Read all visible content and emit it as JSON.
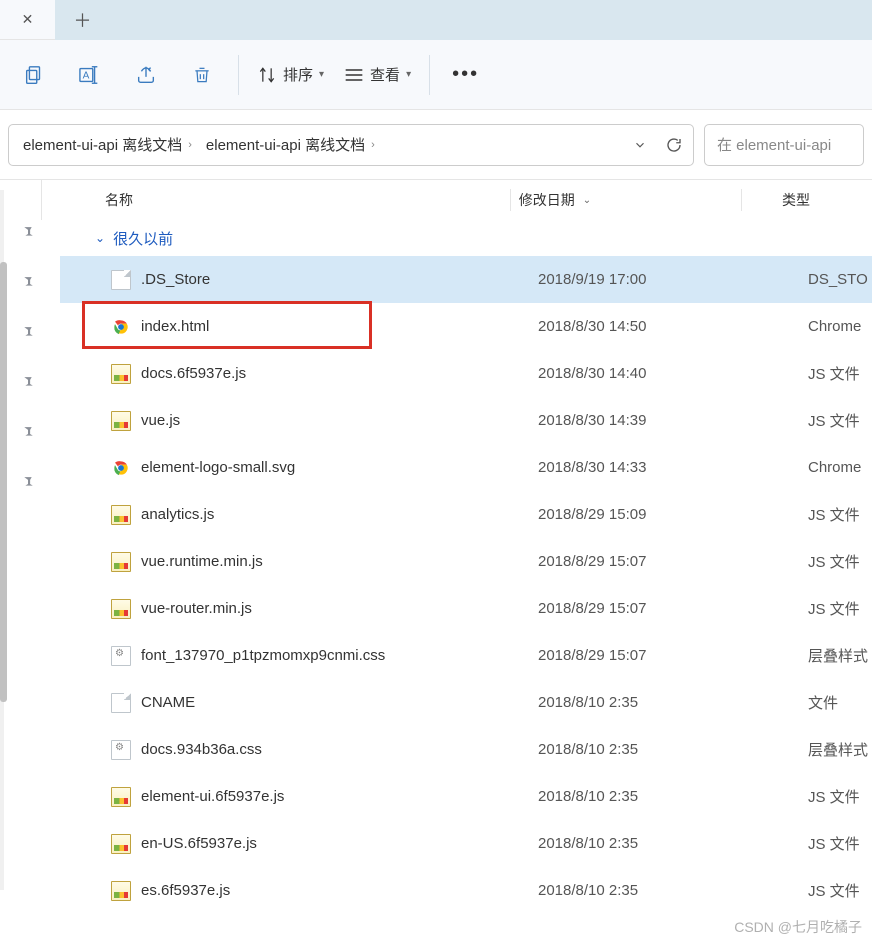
{
  "tabs": {
    "close_glyph": "✕",
    "new_glyph": "＋"
  },
  "toolbar": {
    "sort_label": "排序",
    "view_label": "查看"
  },
  "breadcrumb": {
    "items": [
      "element-ui-api 离线文档",
      "element-ui-api 离线文档"
    ],
    "sep": "›"
  },
  "search": {
    "placeholder": "在 element-ui-api"
  },
  "columns": {
    "name": "名称",
    "date": "修改日期",
    "type": "类型"
  },
  "group": {
    "label": "很久以前"
  },
  "files": [
    {
      "name": ".DS_Store",
      "date": "2018/9/19 17:00",
      "type": "DS_STO",
      "icon": "blank",
      "selected": true
    },
    {
      "name": "index.html",
      "date": "2018/8/30 14:50",
      "type": "Chrome",
      "icon": "chrome",
      "highlight": true
    },
    {
      "name": "docs.6f5937e.js",
      "date": "2018/8/30 14:40",
      "type": "JS 文件",
      "icon": "js"
    },
    {
      "name": "vue.js",
      "date": "2018/8/30 14:39",
      "type": "JS 文件",
      "icon": "js"
    },
    {
      "name": "element-logo-small.svg",
      "date": "2018/8/30 14:33",
      "type": "Chrome",
      "icon": "chrome"
    },
    {
      "name": "analytics.js",
      "date": "2018/8/29 15:09",
      "type": "JS 文件",
      "icon": "js"
    },
    {
      "name": "vue.runtime.min.js",
      "date": "2018/8/29 15:07",
      "type": "JS 文件",
      "icon": "js"
    },
    {
      "name": "vue-router.min.js",
      "date": "2018/8/29 15:07",
      "type": "JS 文件",
      "icon": "js"
    },
    {
      "name": "font_137970_p1tpzmomxp9cnmi.css",
      "date": "2018/8/29 15:07",
      "type": "层叠样式",
      "icon": "gear"
    },
    {
      "name": "CNAME",
      "date": "2018/8/10 2:35",
      "type": "文件",
      "icon": "blank"
    },
    {
      "name": "docs.934b36a.css",
      "date": "2018/8/10 2:35",
      "type": "层叠样式",
      "icon": "gear"
    },
    {
      "name": "element-ui.6f5937e.js",
      "date": "2018/8/10 2:35",
      "type": "JS 文件",
      "icon": "js"
    },
    {
      "name": "en-US.6f5937e.js",
      "date": "2018/8/10 2:35",
      "type": "JS 文件",
      "icon": "js"
    },
    {
      "name": "es.6f5937e.js",
      "date": "2018/8/10 2:35",
      "type": "JS 文件",
      "icon": "js"
    }
  ],
  "watermark": "CSDN @七月吃橘子"
}
